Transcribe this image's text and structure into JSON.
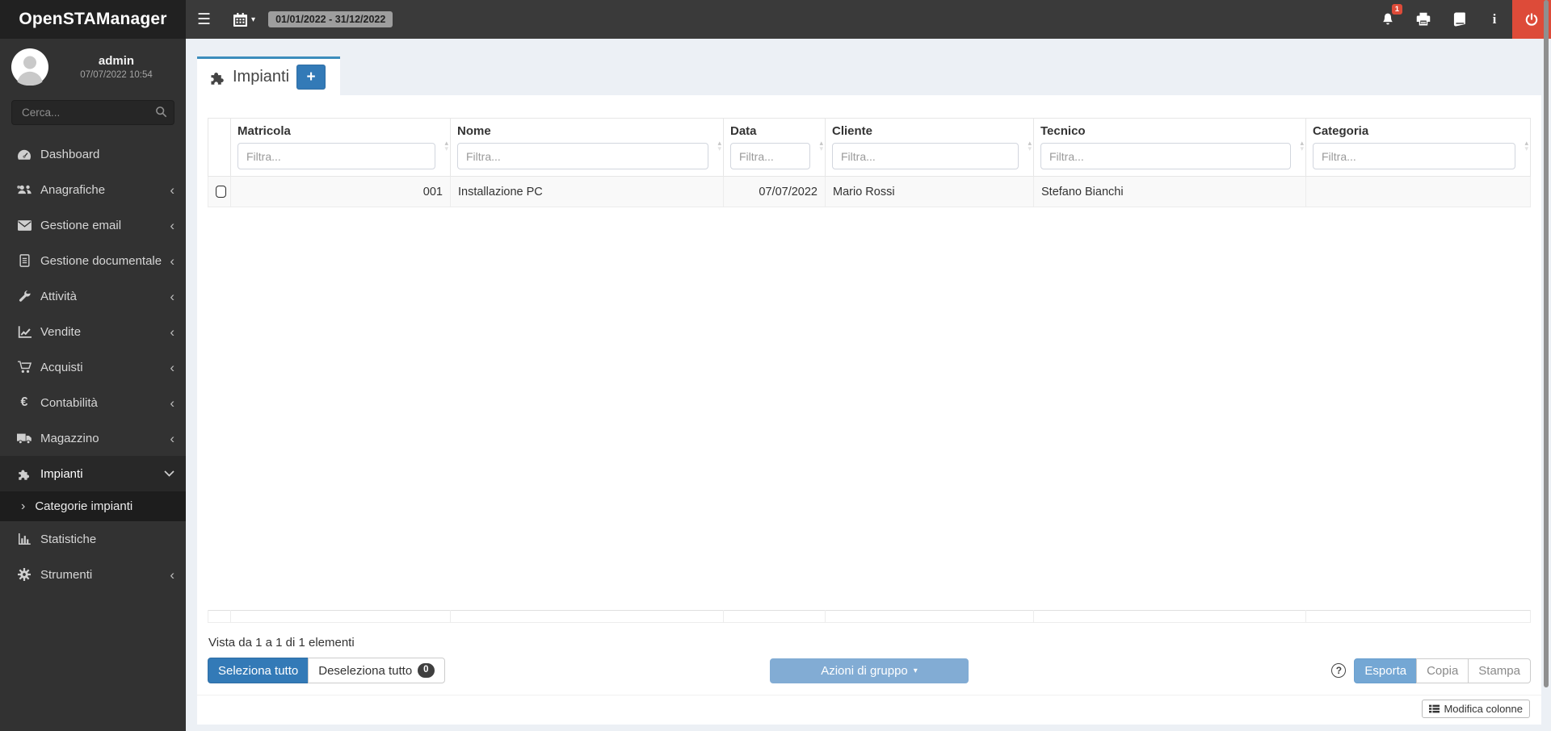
{
  "topbar": {
    "logo": "OpenSTAManager",
    "date_range": "01/01/2022 - 31/12/2022",
    "notification_badge": "1"
  },
  "user": {
    "name": "admin",
    "datetime": "07/07/2022 10:54"
  },
  "search": {
    "placeholder": "Cerca..."
  },
  "icons": {
    "hamburger": "☰",
    "caret_down": "▾",
    "chevron_left": "‹",
    "chevron_right": "›",
    "sort_up": "▴",
    "sort_down": "▾",
    "help": "?",
    "euro": "€",
    "info": "i",
    "plus": "+",
    "gear": "⚙"
  },
  "sidebar": {
    "items": [
      {
        "label": "Dashboard"
      },
      {
        "label": "Anagrafiche"
      },
      {
        "label": "Gestione email"
      },
      {
        "label": "Gestione documentale"
      },
      {
        "label": "Attività"
      },
      {
        "label": "Vendite"
      },
      {
        "label": "Acquisti"
      },
      {
        "label": "Contabilità"
      },
      {
        "label": "Magazzino"
      },
      {
        "label": "Impianti",
        "active": true
      },
      {
        "label": "Categorie impianti",
        "submenu": true
      },
      {
        "label": "Statistiche"
      },
      {
        "label": "Strumenti"
      }
    ]
  },
  "main": {
    "tab": {
      "label": "Impianti"
    },
    "table": {
      "filter_placeholder": "Filtra...",
      "columns": [
        {
          "label": "Matricola"
        },
        {
          "label": "Nome"
        },
        {
          "label": "Data"
        },
        {
          "label": "Cliente"
        },
        {
          "label": "Tecnico"
        },
        {
          "label": "Categoria"
        }
      ],
      "rows": [
        {
          "matricola": "001",
          "nome": "Installazione PC",
          "data": "07/07/2022",
          "cliente": "Mario Rossi",
          "tecnico": "Stefano Bianchi",
          "categoria": ""
        }
      ]
    },
    "footer": {
      "info": "Vista da 1 a 1 di 1 elementi",
      "select_all": "Seleziona tutto",
      "deselect_all": "Deseleziona tutto",
      "deselect_count": "0",
      "group_actions": "Azioni di gruppo",
      "export": "Esporta",
      "copy": "Copia",
      "print": "Stampa",
      "edit_columns": "Modifica colonne"
    }
  },
  "colors": {
    "accent": "#3c8dbc",
    "primary": "#337ab7",
    "danger": "#dd4b39"
  }
}
